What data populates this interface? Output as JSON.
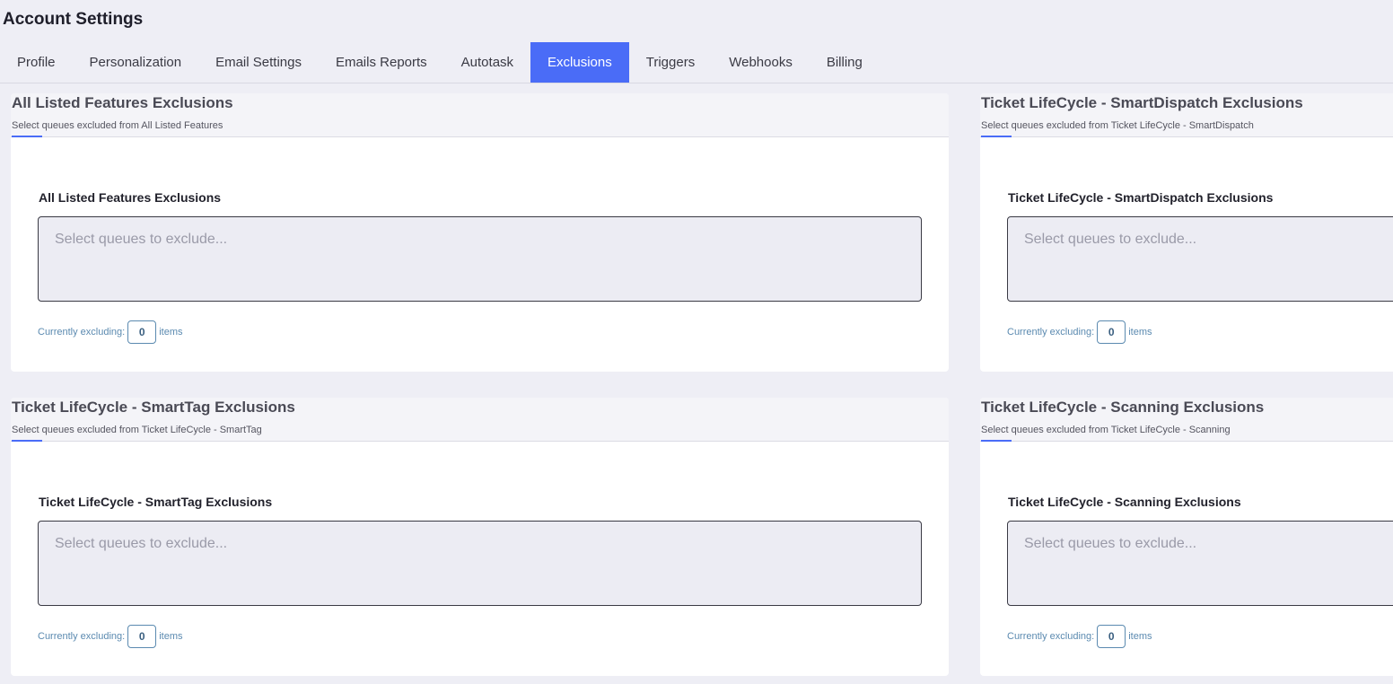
{
  "page": {
    "title": "Account Settings"
  },
  "tabs": [
    {
      "label": "Profile"
    },
    {
      "label": "Personalization"
    },
    {
      "label": "Email Settings"
    },
    {
      "label": "Emails Reports"
    },
    {
      "label": "Autotask"
    },
    {
      "label": "Exclusions",
      "active": true
    },
    {
      "label": "Triggers"
    },
    {
      "label": "Webhooks"
    },
    {
      "label": "Billing"
    }
  ],
  "colors": {
    "accent": "#4a6cf7",
    "count_text": "#5b8ab0"
  },
  "cards": [
    {
      "title": "All Listed Features Exclusions",
      "subtitle": "Select queues excluded from All Listed Features",
      "field_label": "All Listed Features Exclusions",
      "placeholder": "Select queues to exclude...",
      "count_prefix": "Currently excluding:",
      "count": "0",
      "count_suffix": "items"
    },
    {
      "title": "Ticket LifeCycle - SmartDispatch Exclusions",
      "subtitle": "Select queues excluded from Ticket LifeCycle - SmartDispatch",
      "field_label": "Ticket LifeCycle - SmartDispatch Exclusions",
      "placeholder": "Select queues to exclude...",
      "count_prefix": "Currently excluding:",
      "count": "0",
      "count_suffix": "items"
    },
    {
      "title": "Ticket LifeCycle - SmartTag Exclusions",
      "subtitle": "Select queues excluded from Ticket LifeCycle - SmartTag",
      "field_label": "Ticket LifeCycle - SmartTag Exclusions",
      "placeholder": "Select queues to exclude...",
      "count_prefix": "Currently excluding:",
      "count": "0",
      "count_suffix": "items"
    },
    {
      "title": "Ticket LifeCycle - Scanning Exclusions",
      "subtitle": "Select queues excluded from Ticket LifeCycle - Scanning",
      "field_label": "Ticket LifeCycle - Scanning Exclusions",
      "placeholder": "Select queues to exclude...",
      "count_prefix": "Currently excluding:",
      "count": "0",
      "count_suffix": "items"
    }
  ]
}
